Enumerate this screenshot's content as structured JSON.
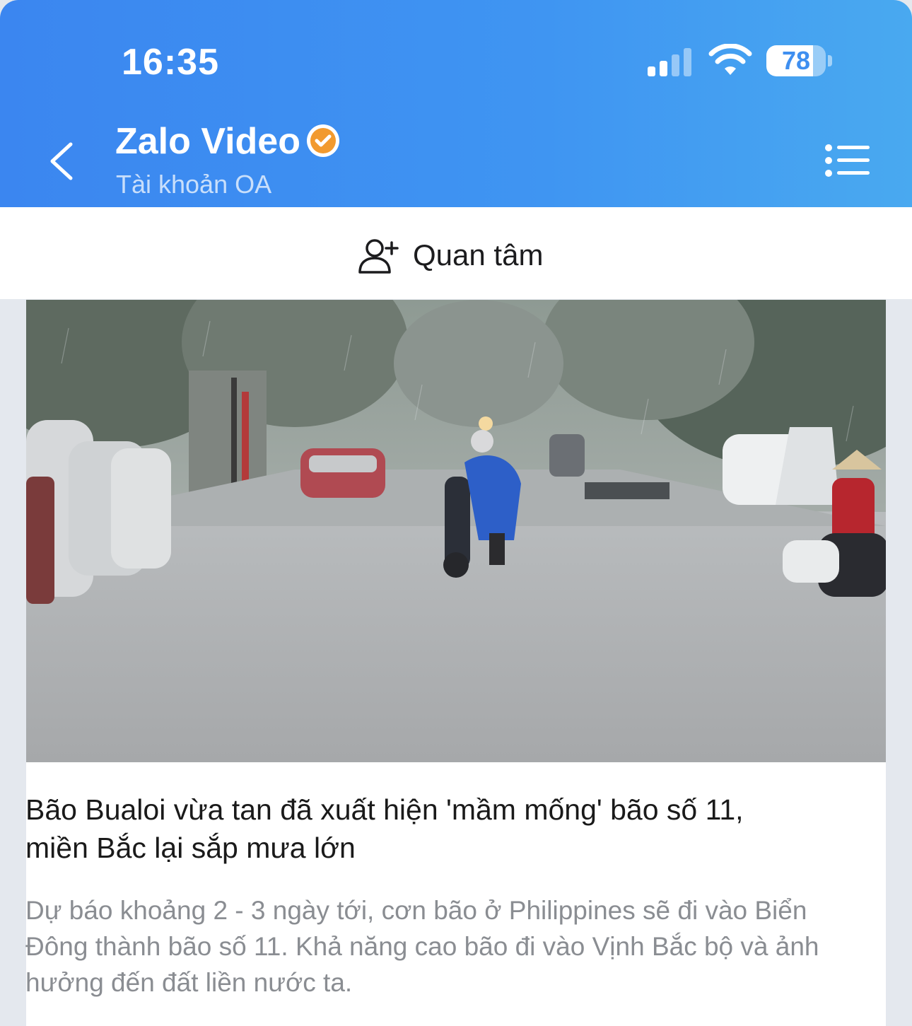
{
  "status_bar": {
    "time": "16:35",
    "battery_level": "78",
    "battery_fraction": 0.78,
    "signal_bars_active": 2,
    "signal_bars_total": 4
  },
  "header": {
    "title": "Zalo Video",
    "subtitle": "Tài khoản OA",
    "back_icon": "chevron-left-icon",
    "verified_icon": "verified-badge-icon",
    "menu_icon": "list-menu-icon",
    "colors": {
      "gradient_start": "#3b86f0",
      "gradient_end": "#49a9f0",
      "verified_badge": "#f29a2e"
    }
  },
  "follow": {
    "label": "Quan tâm",
    "icon": "add-user-icon"
  },
  "article": {
    "image_icon": "flooded-street-photo",
    "title": "Bão Bualoi vừa tan đã xuất hiện 'mầm mống' bão số 11, miền Bắc lại sắp mưa lớn",
    "description": "Dự báo khoảng 2 - 3 ngày tới, cơn bão ở Philippines sẽ đi vào Biển Đông thành bão số 11. Khả năng cao bão đi vào Vịnh Bắc bộ và ảnh hưởng đến đất liền nước ta."
  }
}
